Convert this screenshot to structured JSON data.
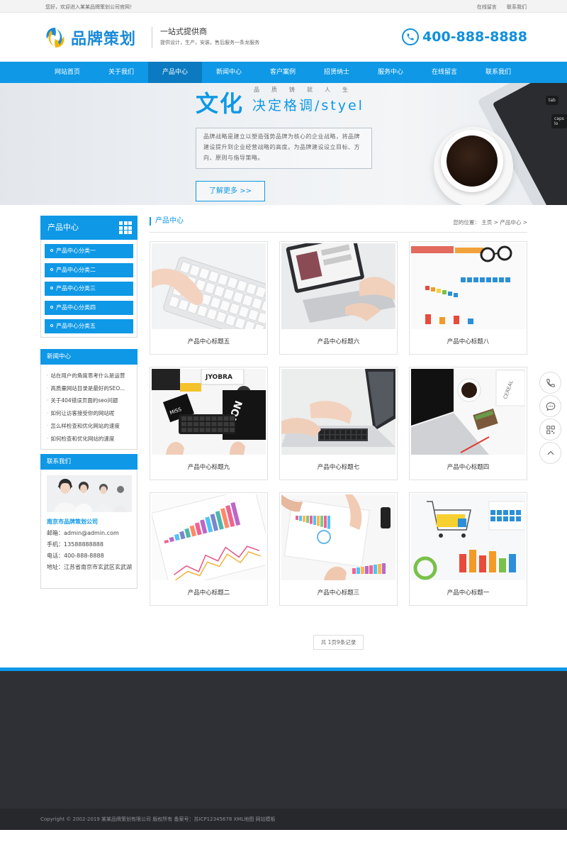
{
  "topbar": {
    "welcome": "您好，欢迎进入某某品牌策划公司官网！",
    "links": [
      "在线留言",
      "联系我们"
    ]
  },
  "header": {
    "logo_text": "品牌策划",
    "slogan_title": "一站式提供商",
    "slogan_sub": "提供设计，生产，安装，售后服务一条龙服务",
    "hotline": "400-888-8888",
    "icons": [
      "logo-mark",
      "phone-icon"
    ]
  },
  "nav": {
    "items": [
      "网站首页",
      "关于我们",
      "产品中心",
      "新闻中心",
      "客户案例",
      "招贤纳士",
      "服务中心",
      "在线留言",
      "联系我们"
    ],
    "active_index": 2
  },
  "banner": {
    "big": "文化",
    "small": "品质铸就人生",
    "tagline": "决定格调/styel",
    "desc": "品牌战略是建立以塑造强势品牌为核心的企业战略，将品牌建设提升到企业经营战略的高度。为品牌建设设立目标、方向、原则与指导策略。",
    "more": "了解更多 >>",
    "keys": [
      "tab",
      "caps lo"
    ]
  },
  "sidebar": {
    "product_title": "产品中心",
    "categories": [
      "产品中心分类一",
      "产品中心分类二",
      "产品中心分类三",
      "产品中心分类四",
      "产品中心分类五"
    ],
    "news_title": "新闻中心",
    "news": [
      "站在用户的角度思考什么是运营",
      "高质量网站目录是最好的SEO...",
      "关于404错误页面的seo问题",
      "如何让访客接受你的网站呢",
      "怎么样检查和优化网站的速度",
      "如何检查和优化网站的速度"
    ],
    "contact_title": "联系我们",
    "company": "南京市品牌策划公司",
    "email": "邮箱：admin@admin.com",
    "mobile": "手机：13588888888",
    "tel": "电话：400-888-8888",
    "address": "地址：江苏省南京市玄武区玄武湖"
  },
  "main": {
    "title": "产品中心",
    "location": "您的位置： 主页 > 产品中心 >",
    "products": [
      {
        "title": "产品中心标题五",
        "scene": "keyboard"
      },
      {
        "title": "产品中心标题六",
        "scene": "laptop-charts"
      },
      {
        "title": "产品中心标题八",
        "scene": "glasses-report"
      },
      {
        "title": "产品中心标题九",
        "scene": "desk-keyboard"
      },
      {
        "title": "产品中心标题七",
        "scene": "laptop-typing"
      },
      {
        "title": "产品中心标题四",
        "scene": "coffee-laptop"
      },
      {
        "title": "产品中心标题二",
        "scene": "line-chart"
      },
      {
        "title": "产品中心标题三",
        "scene": "meeting-hands"
      },
      {
        "title": "产品中心标题一",
        "scene": "cart-charts"
      }
    ],
    "pager": "共 1页9条记录"
  },
  "float_icons": [
    "phone-icon",
    "chat-icon",
    "qrcode-icon",
    "up-arrow-icon"
  ],
  "footer": {
    "copyright": "Copyright © 2002-2019 某某品牌策划有限公司 版权所有   备案号：苏ICP12345678 XML地图 网站模板"
  },
  "colors": {
    "accent": "#0e98e6",
    "nav_active": "#0b7ac0",
    "footer": "#2e3035"
  }
}
